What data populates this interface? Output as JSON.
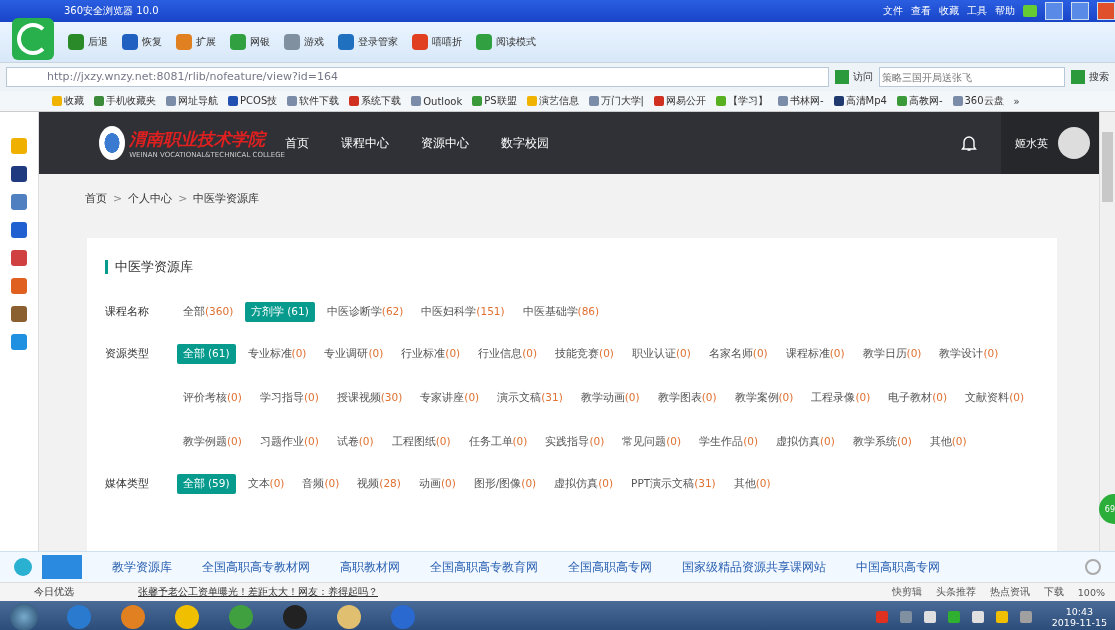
{
  "browser": {
    "title": "360安全浏览器 10.0",
    "menu": [
      "文件",
      "查看",
      "收藏",
      "工具",
      "帮助"
    ],
    "toolbar": [
      {
        "label": "后退",
        "kind": "back"
      },
      {
        "label": "恢复",
        "kind": "restore"
      },
      {
        "label": "扩展",
        "kind": "ext"
      },
      {
        "label": "网银",
        "kind": "bank"
      },
      {
        "label": "游戏",
        "kind": "game"
      },
      {
        "label": "登录管家",
        "kind": "login"
      },
      {
        "label": "嘻嘻折",
        "kind": "deal"
      },
      {
        "label": "阅读模式",
        "kind": "read"
      }
    ],
    "url": "http://jxzy.wnzy.net:8081/rlib/nofeature/view?id=164",
    "visit": "访问",
    "search_placeholder": "策略三国开局送张飞",
    "search_button": "搜索",
    "bookmarks": [
      {
        "label": "收藏",
        "color": "#f0b400"
      },
      {
        "label": "手机收藏夹",
        "color": "#3a8a3a"
      },
      {
        "label": "网址导航",
        "color": "#7a8ca8"
      },
      {
        "label": "PCOS技",
        "color": "#2050b0"
      },
      {
        "label": "软件下载",
        "color": "#7a8ca8"
      },
      {
        "label": "系统下载",
        "color": "#d03020"
      },
      {
        "label": "Outlook",
        "color": "#7a8ca8"
      },
      {
        "label": "PS联盟",
        "color": "#3a9a3a"
      },
      {
        "label": "演艺信息",
        "color": "#f0b400"
      },
      {
        "label": "万门大学|",
        "color": "#7a8ca8"
      },
      {
        "label": "网易公开",
        "color": "#d03020"
      },
      {
        "label": "【学习】",
        "color": "#58b020"
      },
      {
        "label": "书林网-",
        "color": "#7a8ca8"
      },
      {
        "label": "高清Mp4",
        "color": "#203a70"
      },
      {
        "label": "高教网-",
        "color": "#3a9a3a"
      },
      {
        "label": "360云盘",
        "color": "#7a8ca8"
      }
    ],
    "more": "»"
  },
  "page": {
    "logo": "渭南职业技术学院",
    "logo_sub": "WEINAN VOCATIONAL&TECHNICAL COLLEGE",
    "nav": [
      "首页",
      "课程中心",
      "资源中心",
      "数字校园"
    ],
    "user": "姬水英",
    "breadcrumb": [
      "首页",
      "个人中心",
      "中医学资源库"
    ],
    "separator": ">",
    "card_title": "中医学资源库",
    "filters": [
      {
        "label": "课程名称",
        "lines": [
          [
            {
              "name": "全部",
              "count": "(360)",
              "selected": false
            },
            {
              "name": "方剂学",
              "count": "(61)",
              "selected": true
            },
            {
              "name": "中医诊断学",
              "count": "(62)",
              "selected": false
            },
            {
              "name": "中医妇科学",
              "count": "(151)",
              "selected": false
            },
            {
              "name": "中医基础学",
              "count": "(86)",
              "selected": false
            }
          ]
        ]
      },
      {
        "label": "资源类型",
        "lines": [
          [
            {
              "name": "全部",
              "count": "(61)",
              "selected": true
            },
            {
              "name": "专业标准",
              "count": "(0)",
              "selected": false
            },
            {
              "name": "专业调研",
              "count": "(0)",
              "selected": false
            },
            {
              "name": "行业标准",
              "count": "(0)",
              "selected": false
            },
            {
              "name": "行业信息",
              "count": "(0)",
              "selected": false
            },
            {
              "name": "技能竞赛",
              "count": "(0)",
              "selected": false
            },
            {
              "name": "职业认证",
              "count": "(0)",
              "selected": false
            },
            {
              "name": "名家名师",
              "count": "(0)",
              "selected": false
            },
            {
              "name": "课程标准",
              "count": "(0)",
              "selected": false
            },
            {
              "name": "教学日历",
              "count": "(0)",
              "selected": false
            },
            {
              "name": "教学设计",
              "count": "(0)",
              "selected": false
            }
          ],
          [
            {
              "name": "评价考核",
              "count": "(0)",
              "selected": false
            },
            {
              "name": "学习指导",
              "count": "(0)",
              "selected": false
            },
            {
              "name": "授课视频",
              "count": "(30)",
              "selected": false
            },
            {
              "name": "专家讲座",
              "count": "(0)",
              "selected": false
            },
            {
              "name": "演示文稿",
              "count": "(31)",
              "selected": false
            },
            {
              "name": "教学动画",
              "count": "(0)",
              "selected": false
            },
            {
              "name": "教学图表",
              "count": "(0)",
              "selected": false
            },
            {
              "name": "教学案例",
              "count": "(0)",
              "selected": false
            },
            {
              "name": "工程录像",
              "count": "(0)",
              "selected": false
            },
            {
              "name": "电子教材",
              "count": "(0)",
              "selected": false
            },
            {
              "name": "文献资料",
              "count": "(0)",
              "selected": false
            }
          ],
          [
            {
              "name": "教学例题",
              "count": "(0)",
              "selected": false
            },
            {
              "name": "习题作业",
              "count": "(0)",
              "selected": false
            },
            {
              "name": "试卷",
              "count": "(0)",
              "selected": false
            },
            {
              "name": "工程图纸",
              "count": "(0)",
              "selected": false
            },
            {
              "name": "任务工单",
              "count": "(0)",
              "selected": false
            },
            {
              "name": "实践指导",
              "count": "(0)",
              "selected": false
            },
            {
              "name": "常见问题",
              "count": "(0)",
              "selected": false
            },
            {
              "name": "学生作品",
              "count": "(0)",
              "selected": false
            },
            {
              "name": "虚拟仿真",
              "count": "(0)",
              "selected": false
            },
            {
              "name": "教学系统",
              "count": "(0)",
              "selected": false
            },
            {
              "name": "其他",
              "count": "(0)",
              "selected": false
            }
          ]
        ]
      },
      {
        "label": "媒体类型",
        "lines": [
          [
            {
              "name": "全部",
              "count": "(59)",
              "selected": true
            },
            {
              "name": "文本",
              "count": "(0)",
              "selected": false
            },
            {
              "name": "音频",
              "count": "(0)",
              "selected": false
            },
            {
              "name": "视频",
              "count": "(28)",
              "selected": false
            },
            {
              "name": "动画",
              "count": "(0)",
              "selected": false
            },
            {
              "name": "图形/图像",
              "count": "(0)",
              "selected": false
            },
            {
              "name": "虚拟仿真",
              "count": "(0)",
              "selected": false
            },
            {
              "name": "PPT演示文稿",
              "count": "(31)",
              "selected": false
            },
            {
              "name": "其他",
              "count": "(0)",
              "selected": false
            }
          ]
        ]
      }
    ],
    "float_badge": "69"
  },
  "links_bar": [
    "教学资源库",
    "全国高职高专教材网",
    "高职教材网",
    "全国高职高专教育网",
    "全国高职高专网",
    "国家级精品资源共享课网站",
    "中国高职高专网"
  ],
  "news_bar": {
    "label": "今日优选",
    "headline": "张馨予老公工资单曝光！差距太大！网友：养得起吗？",
    "tools": [
      "快剪辑",
      "头条推荐",
      "热点资讯",
      "下载"
    ],
    "zoom": "100%"
  },
  "taskbar": {
    "time": "10:43",
    "date": "2019-11-15"
  }
}
